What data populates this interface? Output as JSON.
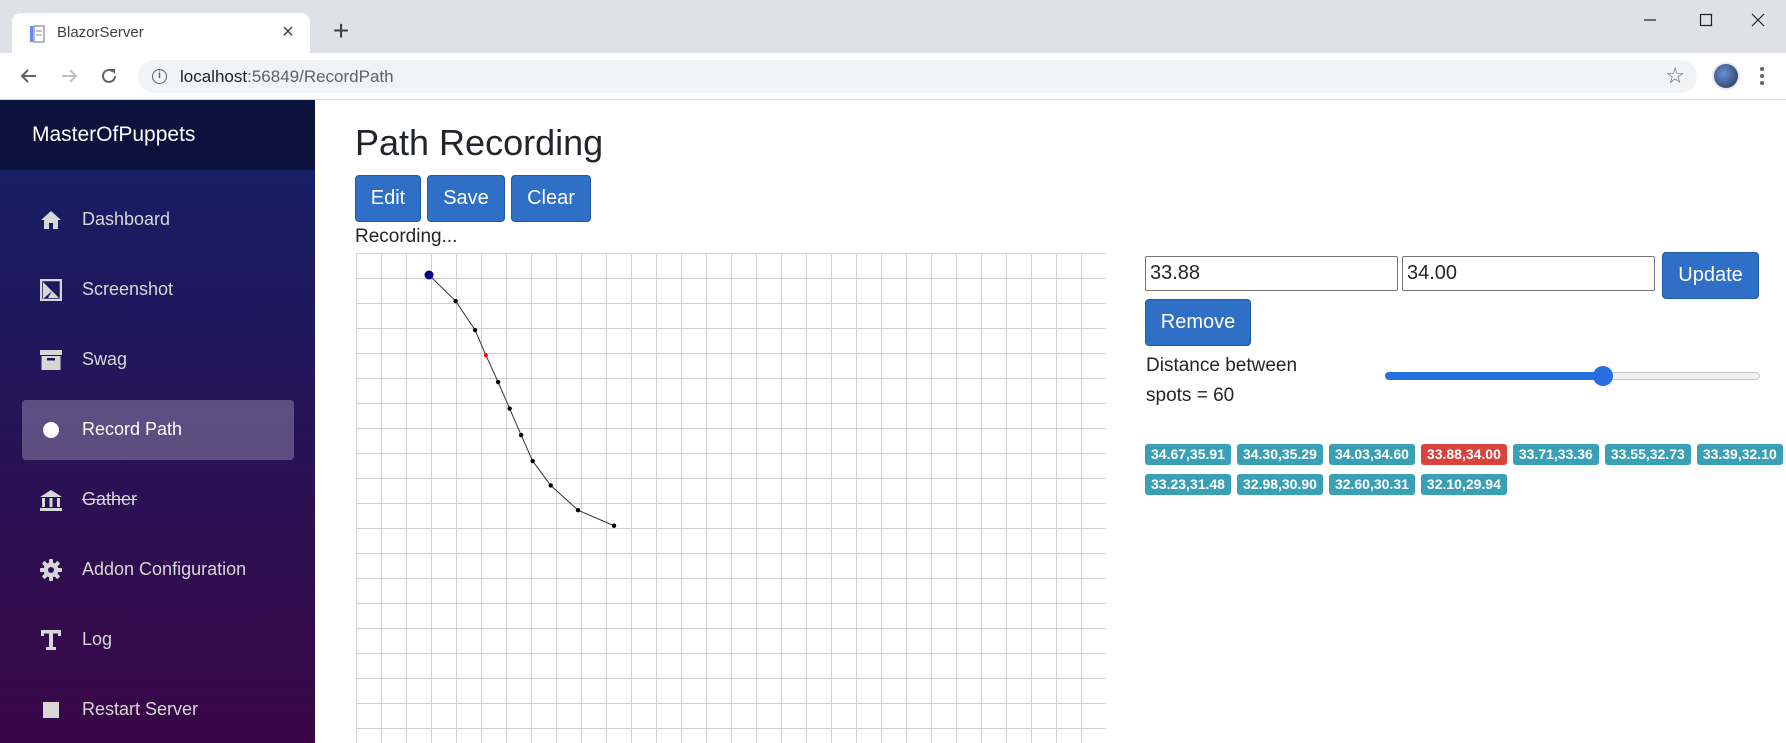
{
  "browser": {
    "tab_title": "BlazorServer",
    "url_host": "localhost",
    "url_path": ":56849/RecordPath"
  },
  "sidebar": {
    "brand": "MasterOfPuppets",
    "items": [
      {
        "label": "Dashboard",
        "icon": "home-icon"
      },
      {
        "label": "Screenshot",
        "icon": "image-icon"
      },
      {
        "label": "Swag",
        "icon": "box-icon"
      },
      {
        "label": "Record Path",
        "icon": "record-icon",
        "active": true
      },
      {
        "label": "Gather",
        "icon": "bank-icon",
        "strikethrough": true
      },
      {
        "label": "Addon Configuration",
        "icon": "gear-icon"
      },
      {
        "label": "Log",
        "icon": "text-icon"
      },
      {
        "label": "Restart Server",
        "icon": "stop-icon"
      }
    ]
  },
  "main": {
    "title": "Path Recording",
    "buttons": {
      "edit": "Edit",
      "save": "Save",
      "clear": "Clear"
    },
    "status": "Recording..."
  },
  "editor": {
    "x_value": "33.88",
    "y_value": "34.00",
    "update_label": "Update",
    "remove_label": "Remove",
    "distance_text": "Distance between spots = 60",
    "distance_value": 60,
    "slider_fraction": 0.58
  },
  "spots": [
    {
      "label": "34.67,35.91"
    },
    {
      "label": "34.30,35.29"
    },
    {
      "label": "34.03,34.60"
    },
    {
      "label": "33.88,34.00",
      "selected": true
    },
    {
      "label": "33.71,33.36"
    },
    {
      "label": "33.55,32.73"
    },
    {
      "label": "33.39,32.10"
    },
    {
      "label": "33.23,31.48"
    },
    {
      "label": "32.98,30.90"
    },
    {
      "label": "32.60,30.31"
    },
    {
      "label": "32.10,29.94"
    }
  ],
  "colors": {
    "primary": "#2f6fc5",
    "badge": "#3aa0b5",
    "badge_selected": "#d9433e",
    "path_start": "#00008b",
    "path_point": "#000000",
    "path_selected": "#ff0000"
  }
}
